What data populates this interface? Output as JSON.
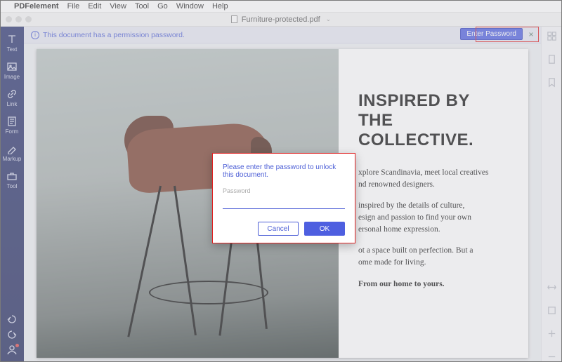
{
  "menubar": {
    "app": "PDFelement",
    "items": [
      "File",
      "Edit",
      "View",
      "Tool",
      "Go",
      "Window",
      "Help"
    ]
  },
  "title": "Furniture-protected.pdf",
  "permission_bar": {
    "text": "This document has a permission password.",
    "button": "Enter Password",
    "close": "×"
  },
  "left_tools": {
    "text": "Text",
    "image": "Image",
    "link": "Link",
    "form": "Form",
    "markup": "Markup",
    "tool": "Tool"
  },
  "document": {
    "headline1": "INSPIRED BY",
    "headline2": "THE COLLECTIVE.",
    "p1_a": "xplore Scandinavia, meet local creatives",
    "p1_b": "nd renowned designers.",
    "p2_a": "inspired by the details of culture,",
    "p2_b": "esign and passion to find your own",
    "p2_c": "ersonal home expression.",
    "p3_a": "ot a space built on perfection. But a",
    "p3_b": "ome made for living.",
    "p4": "From our home to yours."
  },
  "modal": {
    "prompt": "Please enter the password to unlock this document.",
    "label": "Password",
    "value": "",
    "cancel": "Cancel",
    "ok": "OK"
  }
}
